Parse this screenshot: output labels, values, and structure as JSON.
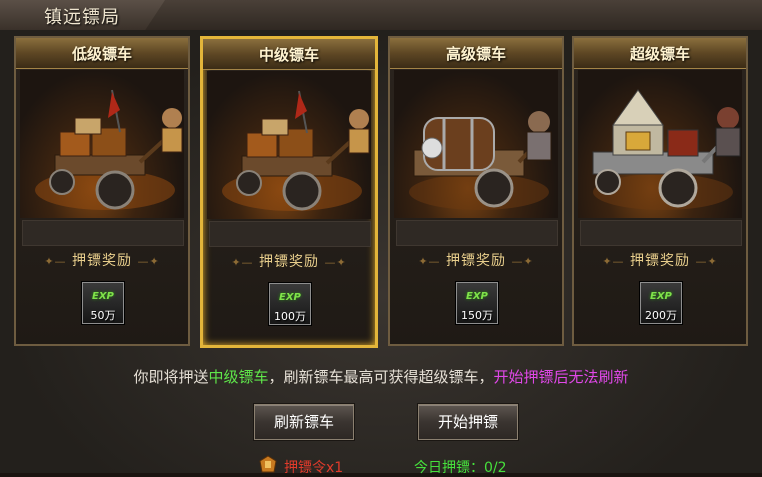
{
  "window": {
    "title": "镇远镖局"
  },
  "cards": [
    {
      "name": "低级镖车",
      "reward_title": "押镖奖励",
      "reward_badge": "EXP",
      "reward_amount": "50万",
      "selected": false
    },
    {
      "name": "中级镖车",
      "reward_title": "押镖奖励",
      "reward_badge": "EXP",
      "reward_amount": "100万",
      "selected": true
    },
    {
      "name": "高级镖车",
      "reward_title": "押镖奖励",
      "reward_badge": "EXP",
      "reward_amount": "150万",
      "selected": false
    },
    {
      "name": "超级镖车",
      "reward_title": "押镖奖励",
      "reward_badge": "EXP",
      "reward_amount": "200万",
      "selected": false
    }
  ],
  "info": {
    "prefix": "你即将押送",
    "current": "中级镖车",
    "middle": "，刷新镖车最高可获得超级镖车，",
    "warning": "开始押镖后无法刷新"
  },
  "buttons": {
    "refresh": "刷新镖车",
    "start": "开始押镖"
  },
  "footer": {
    "token": "押镖令x1",
    "today": "今日押镖：0/2"
  },
  "colors": {
    "selected_border": "#e3b53a",
    "highlight": "#5fe64a",
    "warning": "#e048e8",
    "token": "#e03b2b"
  }
}
